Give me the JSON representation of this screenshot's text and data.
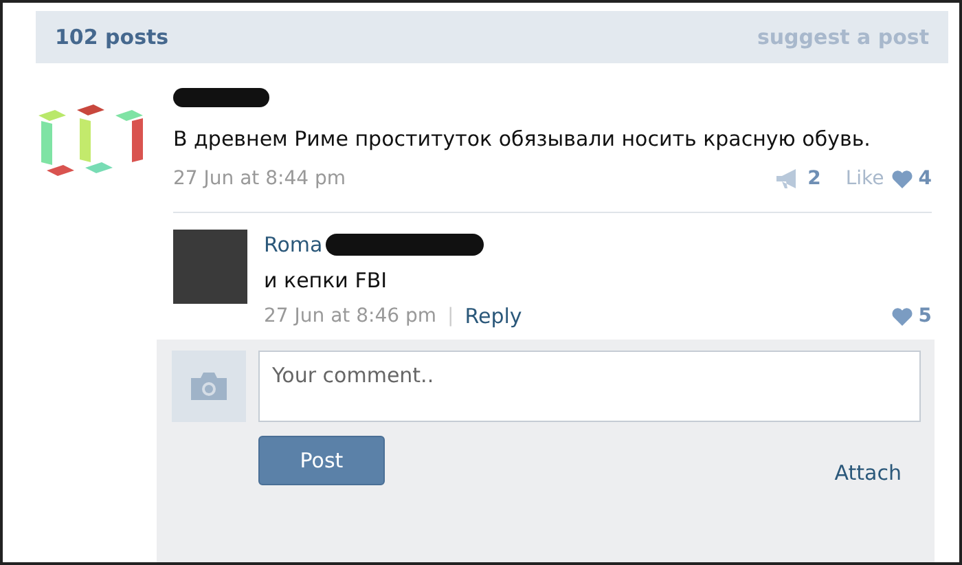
{
  "header": {
    "posts_count": "102 posts",
    "suggest_link": "suggest a post"
  },
  "post": {
    "text": "В древнем Риме проституток обязывали носить красную обувь.",
    "date": "27 Jun at 8:44 pm",
    "reposts": "2",
    "like_label": "Like",
    "likes": "4"
  },
  "comment": {
    "author": "Roma",
    "text": "и кепки FBI",
    "date": "27 Jun at 8:46 pm",
    "separator": "|",
    "reply": "Reply",
    "likes": "5"
  },
  "comment_form": {
    "placeholder": "Your comment..",
    "post_button": "Post",
    "attach": "Attach"
  }
}
